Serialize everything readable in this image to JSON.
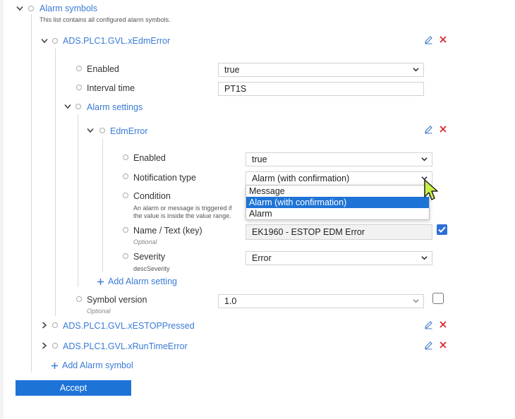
{
  "root": {
    "title": "Alarm symbols",
    "description": "This list contains all configured alarm symbols."
  },
  "symbol1": {
    "name": "ADS.PLC1.GVL.xEdmError",
    "enabled_label": "Enabled",
    "enabled_value": "true",
    "interval_label": "Interval time",
    "interval_value": "PT1S",
    "alarm_settings_label": "Alarm settings",
    "setting": {
      "name": "EdmError",
      "enabled_label": "Enabled",
      "enabled_value": "true",
      "notification_label": "Notification type",
      "notification_value": "Alarm (with confirmation)",
      "notification_options": [
        "Message",
        "Alarm (with confirmation)",
        "Alarm"
      ],
      "condition_label": "Condition",
      "condition_desc_1": "An alarm or message is triggered if",
      "condition_desc_2": "the value is inside the value range.",
      "name_text_label": "Name / Text (key)",
      "name_text_optional": "Optional",
      "name_text_value": "EK1960 - ESTOP EDM Error",
      "name_text_checked": true,
      "severity_label": "Severity",
      "severity_sub": "descSeverity",
      "severity_value": "Error"
    },
    "add_alarm_setting": "Add Alarm setting",
    "symbol_version_label": "Symbol version",
    "symbol_version_optional": "Optional",
    "symbol_version_value": "1.0",
    "symbol_version_checked": false
  },
  "symbol2": {
    "name": "ADS.PLC1.GVL.xESTOPPressed"
  },
  "symbol3": {
    "name": "ADS.PLC1.GVL.xRunTimeError"
  },
  "add_alarm_symbol": "Add Alarm symbol",
  "accept_label": "Accept",
  "colors": {
    "accent": "#1e73d6",
    "link": "#3a7bd5",
    "delete": "#d9242b"
  },
  "icons": [
    "chevron-down-icon",
    "chevron-right-icon",
    "pencil-icon",
    "delete-x-icon",
    "plus-icon",
    "check-icon",
    "mouse-cursor-icon"
  ]
}
